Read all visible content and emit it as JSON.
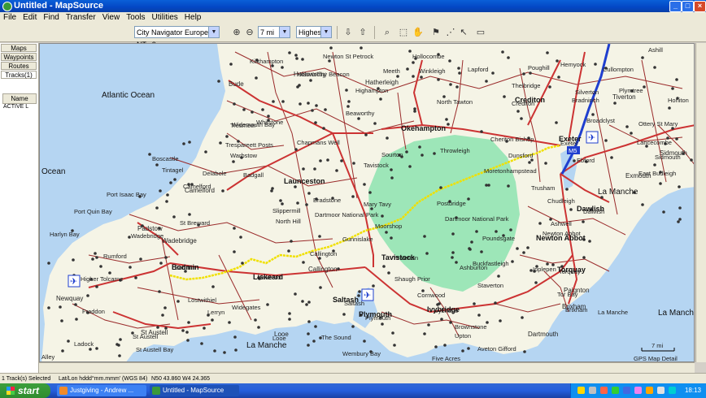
{
  "window": {
    "title": "Untitled - MapSource"
  },
  "menu": [
    "File",
    "Edit",
    "Find",
    "Transfer",
    "View",
    "Tools",
    "Utilities",
    "Help"
  ],
  "toolbar": {
    "map_product": "City Navigator Europe NT v9",
    "zoom_level": "7 mi",
    "detail_level": "Highest"
  },
  "sidebar": {
    "tabs": [
      "Maps",
      "Waypoints",
      "Routes",
      "Tracks(1)"
    ],
    "column_header": "Name",
    "rows": [
      "ACTIVE L"
    ]
  },
  "map": {
    "sea_labels": [
      "Atlantic Ocean",
      "Ocean",
      "La Manche",
      "La Manche",
      "La Manche"
    ],
    "major_towns": [
      "Launceston",
      "Okehampton",
      "Bodmin",
      "Liskeard",
      "Saltash",
      "Plymouth",
      "Tavistock",
      "Newton Abbot",
      "Exeter",
      "Crediton",
      "Torquay",
      "Ivybridge",
      "Dawlish"
    ],
    "towns": [
      "Bude",
      "Holsworthy",
      "Tiverton",
      "Wadebridge",
      "Camelford",
      "Padstow",
      "Newquay",
      "St Austell",
      "Looe",
      "Brixham",
      "Paignton",
      "Sidmouth",
      "Exmouth",
      "Dartmouth",
      "Callington",
      "Hatherleigh"
    ],
    "places": [
      "Kilkhampton",
      "Newton St Petrock",
      "Holsworthy Beacon",
      "Highampton",
      "Meeth",
      "Winkleigh",
      "Lapford",
      "Hollocombe",
      "Poughill",
      "Thelbridge",
      "Cullompton",
      "Ashill",
      "Silverton",
      "Plymtree",
      "Honiton",
      "North Tawton",
      "Crediton",
      "Bradninch",
      "Broadclyst",
      "Ottery St Mary",
      "Lancecombe",
      "Sidmouth",
      "East Budleigh",
      "Widemouth Bay",
      "Whitstone",
      "Beaworthy",
      "Chapmans Well",
      "Sourton",
      "Throwleigh",
      "Cheriton Bishop",
      "Dunsford",
      "Moretonhampstead",
      "Exeter",
      "Ebford",
      "Tresmeer",
      "Trespareett Posts",
      "Warbstow",
      "Boscastle",
      "Tintagel",
      "Delabole",
      "Badgall",
      "Camelford",
      "Bradstone",
      "Mary Tavy",
      "Postbridge",
      "Moorshop",
      "Trusham",
      "Chudleigh",
      "Dawlish",
      "Port Isaac Bay",
      "Port Quin Bay",
      "Harlyn Bay",
      "St Breward",
      "Slippermill",
      "North Hill",
      "Dartmoor National Park",
      "Dartmoor National Park",
      "Gunnislake",
      "Callington",
      "Poundsgate",
      "Newton Abbot",
      "Ashwell",
      "Wadebridge",
      "Rumford",
      "Bodmin",
      "Yelverton",
      "Shaugh Prior",
      "Buckfastleigh",
      "Ipplepen",
      "Torquay",
      "Higher Tolcarne",
      "Liskeard",
      "Lerryn",
      "Lostwithiel",
      "Widegates",
      "Saltash",
      "Plymouth",
      "Cornwood",
      "Ivybridge",
      "Tor Bay",
      "Brixham",
      "Fraddon",
      "St Austell",
      "St Austell Bay",
      "Looe",
      "The Sound",
      "Wembury Bay",
      "Brownstone",
      "Aveton Gifford",
      "Five Acres",
      "Polperro",
      "Ladock",
      "Alley",
      "Hemyock",
      "Tavistock",
      "Upton",
      "Ashburton",
      "Staverton",
      "La Manche"
    ],
    "scale_label": "7 mi",
    "detail_label": "GPS Map Detail",
    "road_shield": "M5"
  },
  "status": {
    "selection": "1 Track(s) Selected",
    "coord_format": "Lat/Lon hddd°mm.mmm' (WGS 84)",
    "position": "N50 43.860 W4 24.365"
  },
  "taskbar": {
    "start": "start",
    "items": [
      "Justgiving - Andrew ...",
      "Untitled - MapSource"
    ],
    "clock": "18:13"
  },
  "colors": {
    "water": "#b5d5f2",
    "land": "#f5f4e6",
    "park": "#9de6b8",
    "road_major": "#cc3333",
    "road_minor": "#8b1a1a",
    "motorway": "#1f3fcf",
    "track": "#f0e000"
  }
}
